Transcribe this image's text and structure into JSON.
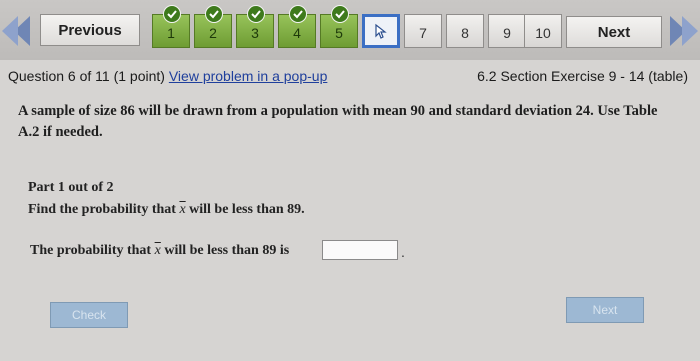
{
  "nav": {
    "previous_label": "Previous",
    "next_label": "Next",
    "questions": [
      {
        "label": "1",
        "state": "done"
      },
      {
        "label": "2",
        "state": "done"
      },
      {
        "label": "3",
        "state": "done"
      },
      {
        "label": "4",
        "state": "done"
      },
      {
        "label": "5",
        "state": "done"
      },
      {
        "label": "",
        "state": "current"
      },
      {
        "label": "7",
        "state": "todo"
      },
      {
        "label": "8",
        "state": "todo"
      },
      {
        "label": "9",
        "state": "todo"
      },
      {
        "label": "10",
        "state": "todo"
      }
    ]
  },
  "header": {
    "question_info": "Question 6 of 11 (1 point)",
    "popup_link": "View problem in a pop-up",
    "section": "6.2 Section Exercise 9 - 14 (table)"
  },
  "problem": {
    "text": "A sample of size 86 will be drawn from a population with mean 90 and standard deviation 24. Use Table A.2 if needed."
  },
  "part": {
    "title": "Part 1 out of 2",
    "question_prefix": "Find the probability that",
    "question_var": "x",
    "question_suffix": "will be less than 89.",
    "answer_prefix": "The probability that",
    "answer_var": "x",
    "answer_suffix": "will be less than 89 is",
    "answer_value": "",
    "answer_end": "."
  },
  "buttons": {
    "check_label": "Check",
    "next_part_label": "Next"
  },
  "colors": {
    "done": "#7aa83d",
    "current_border": "#3b6fc4",
    "link": "#1f3f9c",
    "disabled_button": "#9db8d3"
  }
}
